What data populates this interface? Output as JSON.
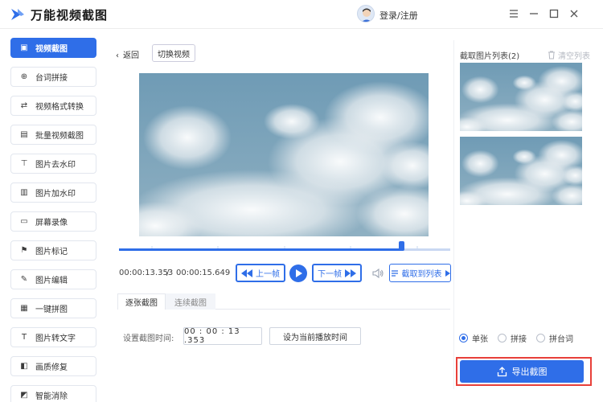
{
  "app": {
    "title": "万能视频截图",
    "login_label": "登录/注册",
    "brand_color": "#2f6ee8"
  },
  "window_controls": [
    {
      "icon": "menu-icon"
    },
    {
      "icon": "minimize-icon"
    },
    {
      "icon": "maximize-icon"
    },
    {
      "icon": "close-icon"
    }
  ],
  "sidebar": {
    "items": [
      {
        "label": "视频截图",
        "icon": "screenshot-icon",
        "active": true
      },
      {
        "label": "台词拼接",
        "icon": "plus-circle-icon",
        "active": false
      },
      {
        "label": "视频格式转换",
        "icon": "convert-icon",
        "active": false
      },
      {
        "label": "批量视频截图",
        "icon": "batch-icon",
        "active": false
      },
      {
        "label": "图片去水印",
        "icon": "stamp-icon",
        "active": false
      },
      {
        "label": "图片加水印",
        "icon": "image-stamp-icon",
        "active": false
      },
      {
        "label": "屏幕录像",
        "icon": "monitor-icon",
        "active": false
      },
      {
        "label": "图片标记",
        "icon": "flag-icon",
        "active": false
      },
      {
        "label": "图片编辑",
        "icon": "edit-icon",
        "active": false
      },
      {
        "label": "一键拼图",
        "icon": "grid-icon",
        "active": false
      },
      {
        "label": "图片转文字",
        "icon": "text-icon",
        "active": false
      },
      {
        "label": "画质修复",
        "icon": "repair-icon",
        "active": false
      },
      {
        "label": "智能消除",
        "icon": "eraser-icon",
        "active": false
      }
    ]
  },
  "main": {
    "back_label": "返回",
    "switch_video_label": "切换视频",
    "current_time": "00:00:13.353",
    "time_separator": "/",
    "total_time": "00:00:15.649",
    "progress": 0.853,
    "prev_frame_label": "上一帧",
    "next_frame_label": "下一帧",
    "capture_to_list_label": "截取到列表",
    "tabs": [
      {
        "label": "逐张截图",
        "active": true
      },
      {
        "label": "连续截图",
        "active": false
      }
    ],
    "set_time_label": "设置截图时间:",
    "time_input_value": "00 : 00 : 13 .353",
    "set_current_label": "设为当前播放时间"
  },
  "right_panel": {
    "title": "截取图片列表(2)",
    "clear_label": "清空列表",
    "modes": [
      {
        "label": "单张",
        "selected": true
      },
      {
        "label": "拼接",
        "selected": false
      },
      {
        "label": "拼台词",
        "selected": false
      }
    ],
    "export_label": "导出截图"
  }
}
